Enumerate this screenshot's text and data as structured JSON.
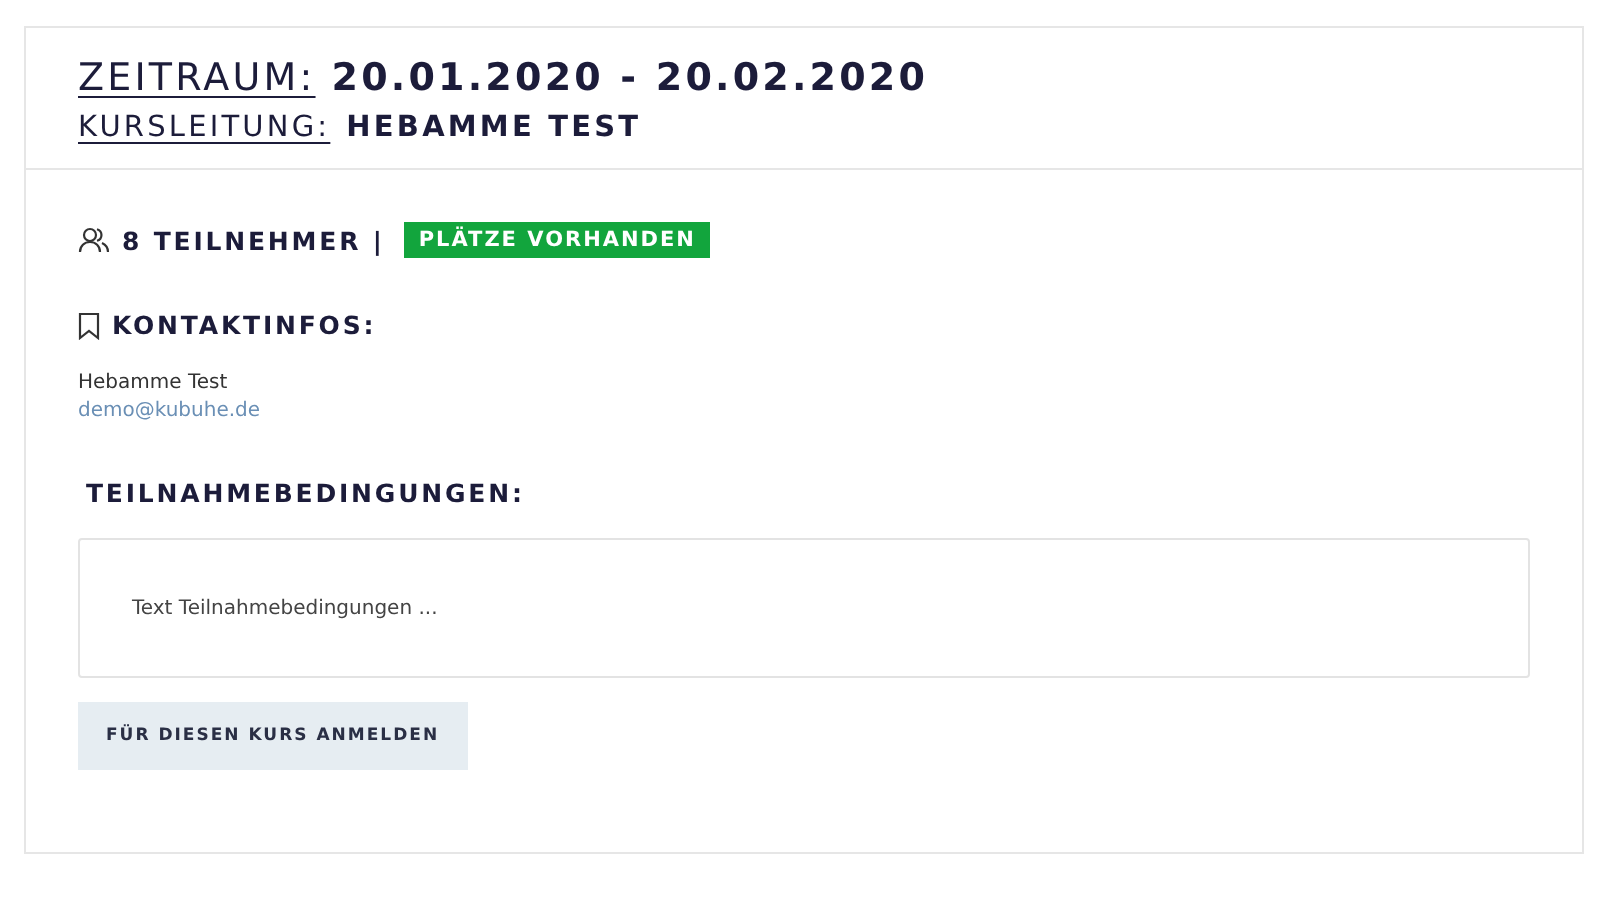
{
  "header": {
    "period_label": "ZEITRAUM:",
    "period_value": "20.01.2020 - 20.02.2020",
    "lead_label": "KURSLEITUNG:",
    "lead_value": "HEBAMME TEST"
  },
  "participants": {
    "count": "8 TEILNEHMER |",
    "badge": "PLÄTZE VORHANDEN"
  },
  "contact": {
    "heading": "KONTAKTINFOS:",
    "name": "Hebamme Test",
    "email": "demo@kubuhe.de"
  },
  "conditions": {
    "heading": "TEILNAHMEBEDINGUNGEN:",
    "text": "Text Teilnahmebedingungen ..."
  },
  "register_button": "FÜR DIESEN KURS ANMELDEN"
}
